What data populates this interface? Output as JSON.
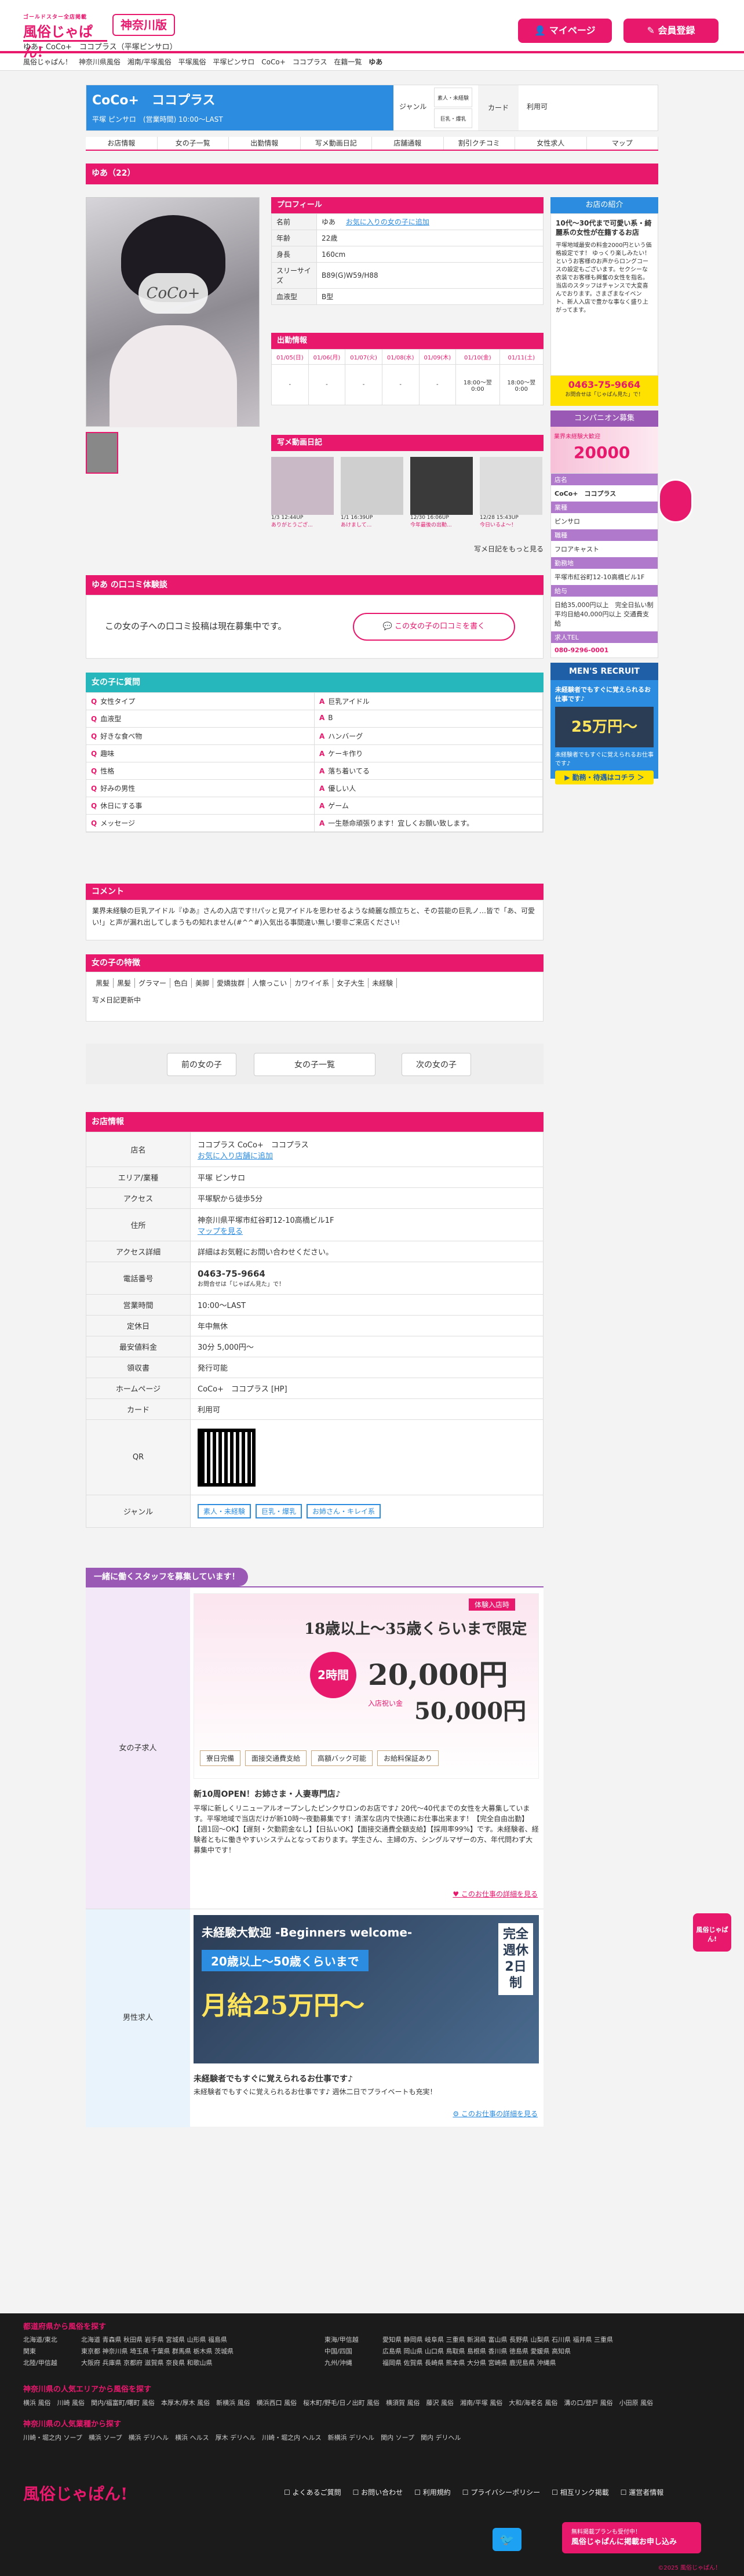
{
  "header": {
    "logo": "風俗じゃぱん!",
    "logo_tag": "ゴールドスター全店掲載",
    "pref": "神奈川版",
    "subtitle": "ゆあ - CoCo+　ココプラス（平塚ピンサロ）",
    "mypage": "マイページ",
    "register": "会員登録"
  },
  "breadcrumb": [
    "風俗じゃぱん！",
    "神奈川県風俗",
    "湘南/平塚風俗",
    "平塚風俗",
    "平塚ピンサロ",
    "CoCo+　ココプラス",
    "在籍一覧",
    "ゆあ"
  ],
  "shop": {
    "name": "CoCo+　ココプラス",
    "meta": "平塚 ピンサロ　(営業時間) 10:00〜LAST",
    "genre_label": "ジャンル",
    "genre_1": "素人・未経験",
    "genre_2": "巨乳・爆乳",
    "card_label": "カード",
    "card_value": "利用可"
  },
  "tabs": [
    "お店情報",
    "女の子一覧",
    "出勤情報",
    "写メ動画日記",
    "店舗通報",
    "割引クチコミ",
    "女性求人",
    "マップ"
  ],
  "girl": {
    "title": "ゆあ（22）",
    "profile_head": "プロフィール",
    "profile": [
      {
        "k": "名前",
        "v": "ゆあ"
      },
      {
        "k": "年齢",
        "v": "22歳"
      },
      {
        "k": "身長",
        "v": "160cm"
      },
      {
        "k": "スリーサイズ",
        "v": "B89(G)W59/H88"
      },
      {
        "k": "血液型",
        "v": "B型"
      }
    ],
    "favorite": "お気に入りの女の子に追加",
    "photo_text": "CoCo+",
    "schedule_head": "出勤情報",
    "schedule_days": [
      "01/05(日)",
      "01/06(月)",
      "01/07(火)",
      "01/08(水)",
      "01/09(木)",
      "01/10(金)",
      "01/11(土)"
    ],
    "schedule_vals": [
      "-",
      "-",
      "-",
      "-",
      "-",
      "18:00〜翌0:00",
      "18:00〜翌0:00"
    ],
    "diary_head": "写メ動画日記",
    "diary": [
      {
        "date": "1/3 12:44UP",
        "text": "ありがとうござ..."
      },
      {
        "date": "1/1 16:39UP",
        "text": "あけまして..."
      },
      {
        "date": "12/30 16:06UP",
        "text": "今年最後の出勤..."
      },
      {
        "date": "12/28 15:43UP",
        "text": "今日いるよ〜！"
      }
    ],
    "diary_more": "写メ日記をもっと見る",
    "review_head": "ゆあ の口コミ体験談",
    "review_empty": "この女の子への口コミ投稿は現在募集中です。",
    "review_btn": "この女の子の口コミを書く",
    "qa_head": "女の子に質問",
    "qa": [
      {
        "q": "女性タイプ",
        "a": "巨乳アイドル"
      },
      {
        "q": "血液型",
        "a": "B"
      },
      {
        "q": "好きな食べ物",
        "a": "ハンバーグ"
      },
      {
        "q": "趣味",
        "a": "ケーキ作り"
      },
      {
        "q": "性格",
        "a": "落ち着いてる"
      },
      {
        "q": "好みの男性",
        "a": "優しい人"
      },
      {
        "q": "休日にする事",
        "a": "ゲーム"
      },
      {
        "q": "メッセージ",
        "a": "一生懸命頑張ります！宜しくお願い致します。"
      }
    ],
    "comment_head": "コメント",
    "comment": "業界未経験の巨乳アイドル『ゆあ』さんの入店です!!パッと見アイドルを思わせるような綺麗な顔立ちと、その芸能の巨乳ノ…皆で「あ、可愛い!」と声が漏れ出してしまうもの知れません(#^^#)入気出る事間違い無し!要非ご来店ください!",
    "feature_head": "女の子の特徴",
    "features": [
      "黒髪",
      "黒髪",
      "グラマー",
      "色白",
      "美脚",
      "愛嬌抜群",
      "人懐っこい",
      "カワイイ系",
      "女子大生",
      "未経験"
    ],
    "feature_extra": "写メ日記更新中",
    "prev": "前の女の子",
    "list": "女の子一覧",
    "next": "次の女の子"
  },
  "shopinfo": {
    "head": "お店情報",
    "rows": [
      {
        "k": "店名",
        "v": "ココプラス CoCo+　ココプラス",
        "v2": "お気に入り店舗に追加"
      },
      {
        "k": "エリア/業種",
        "v": "平塚 ピンサロ"
      },
      {
        "k": "アクセス",
        "v": "平塚駅から徒歩5分"
      },
      {
        "k": "住所",
        "v": "神奈川県平塚市紅谷町12-10高橋ビル1F",
        "v2": "マップを見る"
      },
      {
        "k": "アクセス詳細",
        "v": "詳細はお気軽にお問い合わせください。"
      },
      {
        "k": "電話番号",
        "v": "0463-75-9664",
        "v2": "お問合せは「じゃぱん見た」で！"
      },
      {
        "k": "営業時間",
        "v": "10:00〜LAST"
      },
      {
        "k": "定休日",
        "v": "年中無休"
      },
      {
        "k": "最安値料金",
        "v": "30分 5,000円〜"
      },
      {
        "k": "領収書",
        "v": "発行可能"
      },
      {
        "k": "ホームページ",
        "v": "CoCo+　ココプラス [HP]"
      },
      {
        "k": "カード",
        "v": "利用可"
      }
    ],
    "qr_label": "QR",
    "genre_label": "ジャンル",
    "genres": [
      "素人・未経験",
      "巨乳・爆乳",
      "お姉さん・キレイ系"
    ]
  },
  "recruit": {
    "head": "一緒に働くスタッフを募集しています！",
    "female_label": "女の子求人",
    "banner_top": "18歳以上〜35歳くらいまで限定",
    "banner_tag": "体験入店時",
    "banner_hours": "2時間",
    "banner_pay": "20,000円",
    "banner_pay2": "50,000円",
    "banner_note": "入店祝い金",
    "banner_items": [
      "寮日完備",
      "面接交通費支給",
      "高額バック可能",
      "お給料保証あり"
    ],
    "female_title": "新10周OPEN！お姉さま・人妻専門店♪",
    "female_text": "平塚に新しくリニューアルオープンしたピンクサロンのお店です♪ 20代〜40代までの女性を大募集しています。平塚地域で当店だけが新10時〜夜勤募集です！清潔な店内で快適にお仕事出来ます！【完全自由出勤】【週1回〜OK】【遅刻・欠勤罰金なし】【日払いOK】【面接交通費全額支給】【採用率99%】です。未経験者、経験者ともに働きやすいシステムとなっております。学生さん、主婦の方、シングルマザーの方、年代問わず大募集中です！",
    "female_more": "このお仕事の詳細を見る",
    "male_label": "男性求人",
    "male_banner1": "未経験大歓迎 -Beginners welcome-",
    "male_banner2": "20歳以上〜50歳くらいまで",
    "male_banner3": "月給25万円〜",
    "male_banner4": "完全週休2日制",
    "male_title": "未経験者でもすぐに覚えられるお仕事です♪",
    "male_text": "未経験者でもすぐに覚えられるお仕事です♪ 週休二日でプライベートも充実！",
    "male_more": "このお仕事の詳細を見る"
  },
  "side": {
    "intro_head": "お店の紹介",
    "intro_title": "10代〜30代まで可愛い系・綺麗系の女性が在籍するお店",
    "intro_text": "平塚地域最安の料金2000円という価格設定です！ ゆっくり楽しみたい！というお客様のお声からロングコースの設定もございます。セクシーな衣装でお客様も興奮の女性を指名。当店のスタッフはチャンスで大変喜んでおります。さまざまなイベント、新人入店で豊かな事なく盛り上がってます。",
    "tel": "0463-75-9664",
    "tel_note": "お問合せは「じゃぱん見た」で！",
    "comp_head": "コンパニオン募集",
    "comp_banner_a": "業界未経験大歓迎",
    "comp_banner_b": "20000",
    "comp_rows": [
      {
        "k": "店名",
        "v": "CoCo+　ココプラス"
      },
      {
        "k": "業種",
        "v": "ピンサロ"
      },
      {
        "k": "職種",
        "v": "フロアキャスト"
      },
      {
        "k": "勤務地",
        "v": "平塚市紅谷町12-10高橋ビル1F"
      },
      {
        "k": "給与",
        "v": "日給35,000円以上　完全日払い制 平均日給40,000円以上 交通費支給"
      },
      {
        "k": "求人TEL",
        "v": "080-9296-0001"
      }
    ],
    "men_head": "MEN'S RECRUIT",
    "men_title": "未経験者でもすぐに覚えられるお仕事です♪",
    "men_pay": "25万円〜",
    "men_text": "未経験者でもすぐに覚えられるお仕事です♪",
    "men_btn": "▶ 勤務・待遇はコチラ ＞"
  },
  "footer": {
    "sec1": "都道府県から風俗を探す",
    "regions": [
      "北海道/東北",
      "関東",
      "北陸/甲信越",
      "東海/甲信越",
      "近畿",
      "中国/四国",
      "九州/沖縄"
    ],
    "pref_line1": "北海道 青森県 秋田県 岩手県 宮城県 山形県 福島県",
    "pref_line2": "東京都 神奈川県 埼玉県 千葉県 群馬県 栃木県 茨城県",
    "pref_line3": "大阪府 兵庫県 京都府 滋賀県 奈良県 和歌山県",
    "pref_line4": "愛知県 静岡県 岐阜県 三重県 新潟県 富山県 長野県 山梨県 石川県 福井県 三重県",
    "pref_line5": "広島県 岡山県 山口県 鳥取県 島根県 香川県 徳島県 愛媛県 高知県",
    "pref_line6": "福岡県 佐賀県 長崎県 熊本県 大分県 宮崎県 鹿児島県 沖縄県",
    "sec2": "神奈川県の人気エリアから風俗を探す",
    "areas": "横浜 風俗　川崎 風俗　関内/福富町/曙町 風俗　本厚木/厚木 風俗　新横浜 風俗　横浜西口 風俗　桜木町/野毛/日ノ出町 風俗　横須賀 風俗　藤沢 風俗　湘南/平塚 風俗　大和/海老名 風俗　溝の口/登戸 風俗　小田原 風俗",
    "sec3": "神奈川県の人気業種から探す",
    "genres": "川崎・堀之内 ソープ　横浜 ソープ　横浜 デリヘル　横浜 ヘルス　厚木 デリヘル　川崎・堀之内 ヘルス　新横浜 デリヘル　関内 ソープ　関内 デリヘル",
    "logo": "風俗じゃぱん!",
    "links": [
      "よくあるご質問",
      "お問い合わせ",
      "利用規約",
      "プライバシーポリシー",
      "相互リンク掲載",
      "運営者情報"
    ],
    "ad_small": "無料掲載プランも受付中！",
    "ad_big": "風俗じゃぱんに掲載お申し込み",
    "copy": "©2025 風俗じゃぱん！"
  },
  "colors": {
    "accent": "#e8186d",
    "blue": "#2c8ce0",
    "teal": "#26b7bc",
    "purple": "#9b59b6"
  }
}
